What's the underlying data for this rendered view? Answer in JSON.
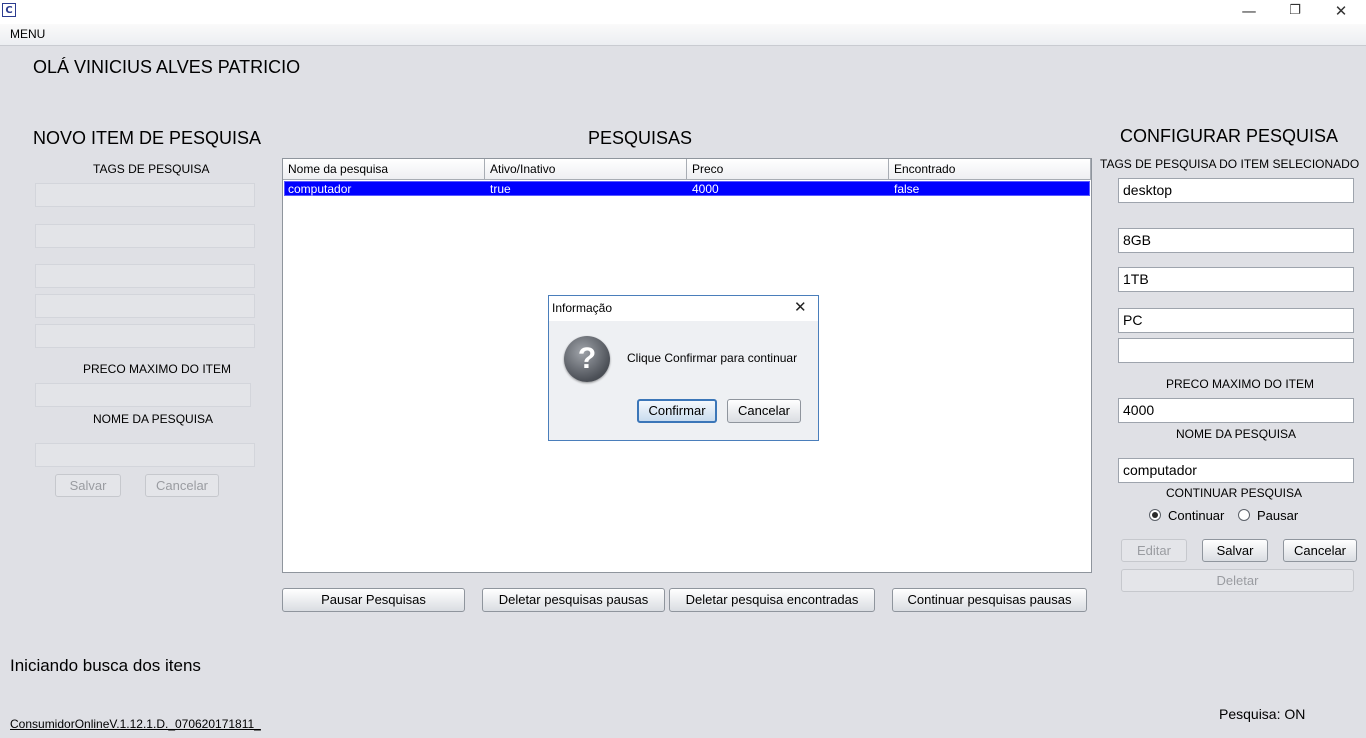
{
  "window": {
    "minimize_glyph": "—",
    "restore_glyph": "❐",
    "close_glyph": "✕"
  },
  "menu": {
    "label": "MENU"
  },
  "greeting": "OLÁ  VINICIUS ALVES PATRICIO",
  "left_panel": {
    "title": "NOVO ITEM DE PESQUISA",
    "tags_label": "TAGS DE PESQUISA",
    "price_label": "PRECO MAXIMO DO ITEM",
    "name_label": "NOME DA PESQUISA",
    "save_label": "Salvar",
    "cancel_label": "Cancelar"
  },
  "center_panel": {
    "title": "PESQUISAS",
    "columns": [
      "Nome da pesquisa",
      "Ativo/Inativo",
      "Preco",
      "Encontrado"
    ],
    "rows": [
      [
        "computador",
        "true",
        "4000",
        "false"
      ]
    ],
    "buttons": {
      "pause": "Pausar Pesquisas",
      "delete_paused": "Deletar pesquisas pausas",
      "delete_found": "Deletar pesquisa encontradas",
      "continue_paused": "Continuar pesquisas pausas"
    }
  },
  "right_panel": {
    "title": "CONFIGURAR PESQUISA",
    "tags_label": "TAGS DE PESQUISA DO ITEM SELECIONADO",
    "tags": [
      "desktop",
      "8GB",
      "1TB",
      "PC",
      ""
    ],
    "price_label": "PRECO MAXIMO DO ITEM",
    "price_value": "4000",
    "name_label": "NOME DA PESQUISA",
    "name_value": "computador",
    "continue_label": "CONTINUAR PESQUISA",
    "radio_continue": "Continuar",
    "radio_pause": "Pausar",
    "selected_option": "Continuar",
    "edit_label": "Editar",
    "save_label": "Salvar",
    "cancel_label": "Cancelar",
    "delete_label": "Deletar"
  },
  "dialog": {
    "title": "Informação",
    "message": "Clique Confirmar para continuar",
    "confirm_label": "Confirmar",
    "cancel_label": "Cancelar",
    "close_glyph": "✕",
    "icon_glyph": "?"
  },
  "status": {
    "message": "Iniciando busca dos itens",
    "version": "ConsumidorOnlineV.1.12.1.D._070620171811_",
    "search_state": "Pesquisa: ON"
  },
  "colors": {
    "selection": "#0000ff",
    "dialog_border": "#4a7ebb",
    "background": "#dfe0e5"
  }
}
